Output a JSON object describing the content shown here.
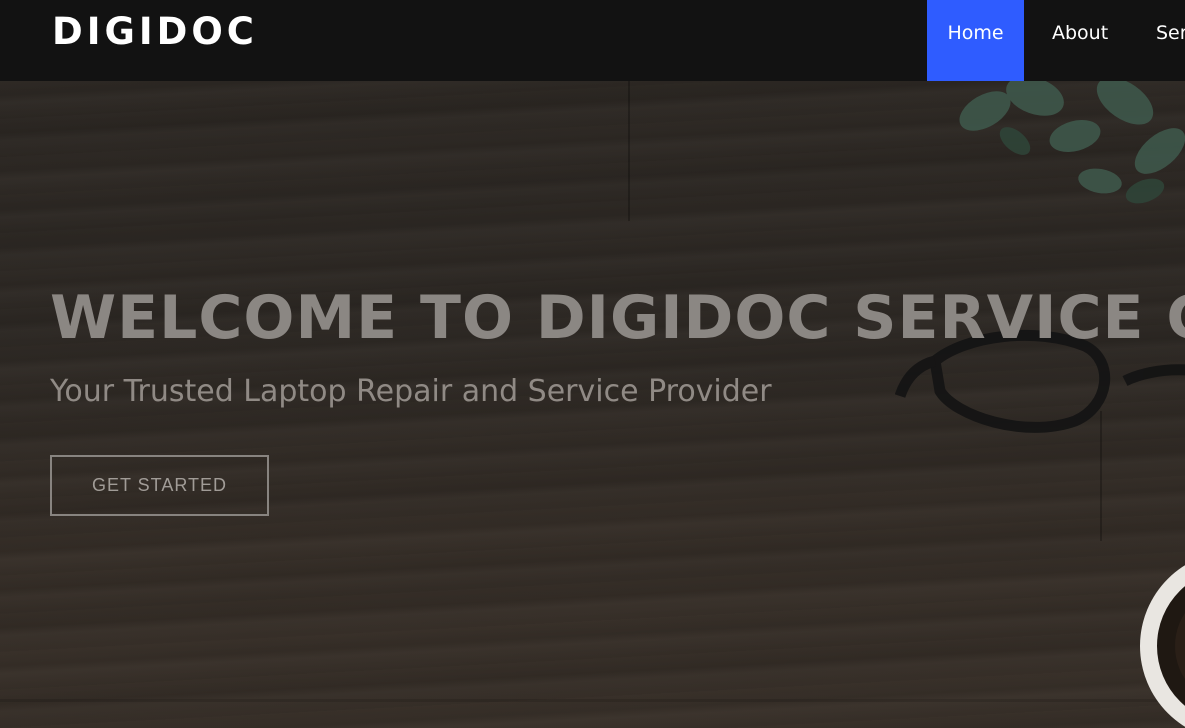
{
  "brand": {
    "name": "DIGIDOC"
  },
  "nav": {
    "items": [
      {
        "label": "Home",
        "active": true
      },
      {
        "label": "About",
        "active": false
      },
      {
        "label": "Ser",
        "active": false
      }
    ]
  },
  "hero": {
    "title": "WELCOME TO DIGIDOC SERVICE CE",
    "subtitle": "Your Trusted Laptop Repair and Service Provider",
    "cta_label": "GET STARTED"
  },
  "colors": {
    "navbar_bg": "#121212",
    "active_nav": "#2f5cff",
    "hero_text": "#8b8783"
  }
}
